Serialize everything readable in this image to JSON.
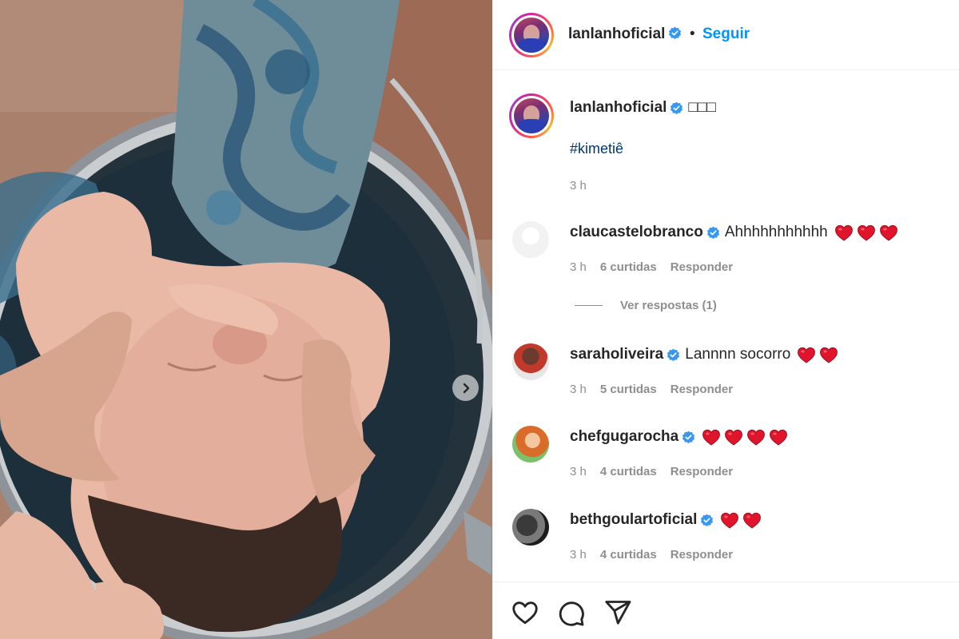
{
  "post": {
    "author": "lanlanhoficial",
    "follow_label": "Seguir",
    "separator": "•",
    "caption_emojis": "□□□",
    "hashtag": "#kimetiê",
    "caption_time": "3 h"
  },
  "comments": [
    {
      "user": "claucastelobranco",
      "text": "Ahhhhhhhhhhh",
      "hearts": 3,
      "time": "3 h",
      "likes": "6 curtidas",
      "reply": "Responder",
      "view_replies": "Ver respostas (1)"
    },
    {
      "user": "saraholiveira",
      "text": "Lannnn socorro",
      "hearts": 2,
      "time": "3 h",
      "likes": "5 curtidas",
      "reply": "Responder"
    },
    {
      "user": "chefgugarocha",
      "text": "",
      "hearts": 4,
      "time": "3 h",
      "likes": "4 curtidas",
      "reply": "Responder"
    },
    {
      "user": "bethgoulartoficial",
      "text": "",
      "hearts": 2,
      "time": "3 h",
      "likes": "4 curtidas",
      "reply": "Responder"
    }
  ],
  "colors": {
    "link": "#0095f6",
    "hashtag": "#00376b",
    "muted": "#8e8e8e",
    "verified": "#3897f0",
    "heart": "#e0142b"
  },
  "icons": {
    "verified": "verified-badge-icon",
    "like": "heart-outline-icon",
    "comment": "comment-bubble-icon",
    "share": "paper-plane-icon",
    "next": "chevron-right-icon",
    "comment_heart": "red-heart-emoji-icon"
  }
}
